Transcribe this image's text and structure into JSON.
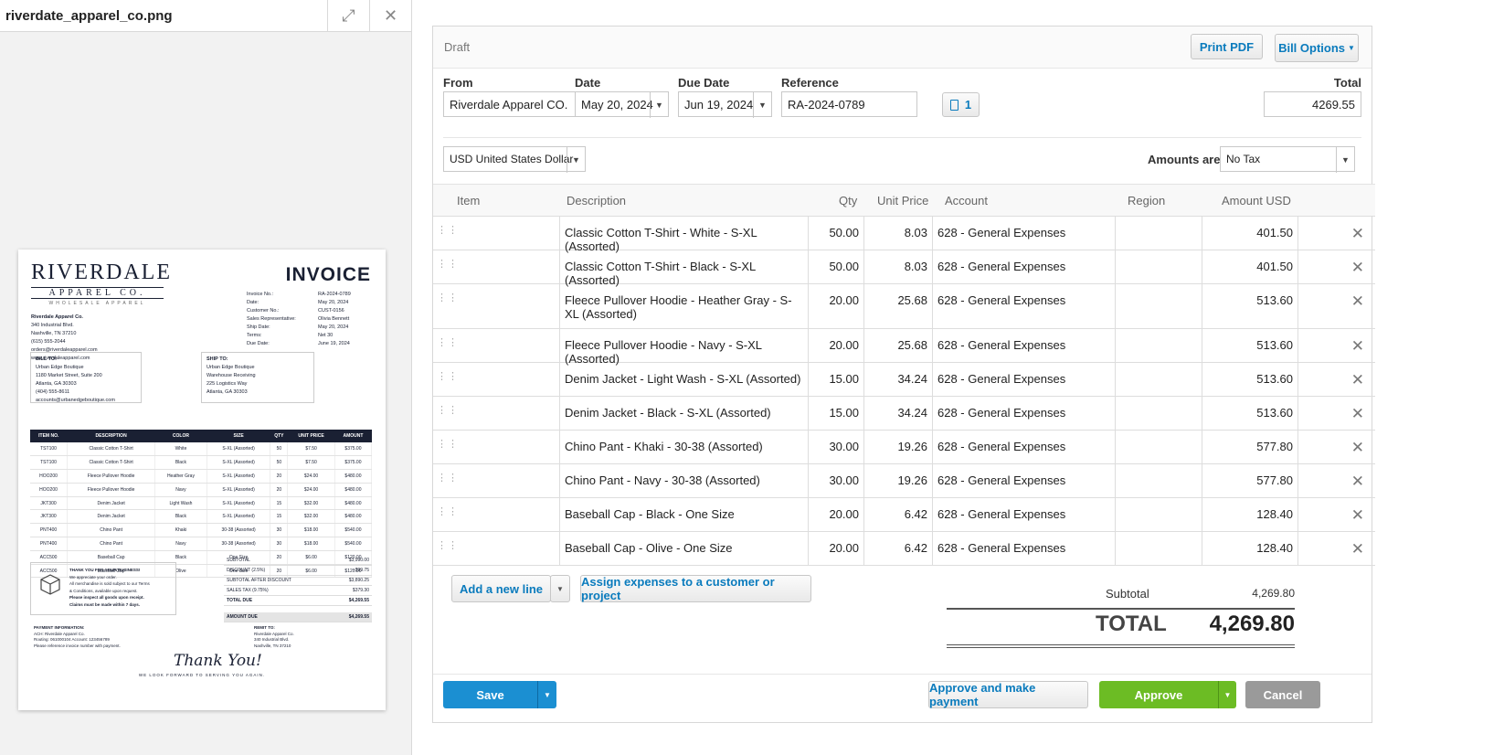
{
  "preview": {
    "filename": "riverdate_apparel_co.png",
    "document": {
      "logo": "RIVERDALE",
      "logo_sub": "APPAREL CO.",
      "logo_tag": "WHOLESALE APPAREL",
      "heading": "INVOICE",
      "company_lines": [
        "Riverdale Apparel Co.",
        "340 Industrial Blvd.",
        "Nashville, TN 37210",
        "(615) 555-2044",
        "orders@riverdaleapparel.com",
        "www.riverdaleapparel.com"
      ],
      "meta": [
        [
          "Invoice No.:",
          "RA-2024-0789"
        ],
        [
          "Date:",
          "May 20, 2024"
        ],
        [
          "Customer No.:",
          "CUST-0156"
        ],
        [
          "Sales Representative:",
          "Olivia Bennett"
        ],
        [
          "Ship Date:",
          "May 20, 2024"
        ],
        [
          "Terms:",
          "Net 30"
        ],
        [
          "Due Date:",
          "June 19, 2024"
        ]
      ],
      "bill_to": [
        "BILL TO:",
        "Urban Edge Boutique",
        "1180 Market Street, Suite 200",
        "Atlanta, GA 30303",
        "(404) 555-8611",
        "accounts@urbanedgeboutique.com"
      ],
      "ship_to": [
        "SHIP TO:",
        "Urban Edge Boutique",
        "Warehouse Receiving",
        "225 Logistics Way",
        "Atlanta, GA 30303"
      ],
      "table_headers": [
        "ITEM NO.",
        "DESCRIPTION",
        "COLOR",
        "SIZE",
        "QTY",
        "UNIT PRICE",
        "AMOUNT"
      ],
      "table_rows": [
        [
          "TST100",
          "Classic Cotton T-Shirt",
          "White",
          "S-XL (Assorted)",
          "50",
          "$7.50",
          "$375.00"
        ],
        [
          "TST100",
          "Classic Cotton T-Shirt",
          "Black",
          "S-XL (Assorted)",
          "50",
          "$7.50",
          "$375.00"
        ],
        [
          "HOO200",
          "Fleece Pullover Hoodie",
          "Heather Gray",
          "S-XL (Assorted)",
          "20",
          "$24.00",
          "$480.00"
        ],
        [
          "HOO200",
          "Fleece Pullover Hoodie",
          "Navy",
          "S-XL (Assorted)",
          "20",
          "$24.00",
          "$480.00"
        ],
        [
          "JKT300",
          "Denim Jacket",
          "Light Wash",
          "S-XL (Assorted)",
          "15",
          "$32.00",
          "$480.00"
        ],
        [
          "JKT300",
          "Denim Jacket",
          "Black",
          "S-XL (Assorted)",
          "15",
          "$32.00",
          "$480.00"
        ],
        [
          "PNT400",
          "Chino Pant",
          "Khaki",
          "30-38 (Assorted)",
          "30",
          "$18.00",
          "$540.00"
        ],
        [
          "PNT400",
          "Chino Pant",
          "Navy",
          "30-38 (Assorted)",
          "30",
          "$18.00",
          "$540.00"
        ],
        [
          "ACC500",
          "Baseball Cap",
          "Black",
          "One Size",
          "20",
          "$6.00",
          "$120.00"
        ],
        [
          "ACC500",
          "Baseball Cap",
          "Olive",
          "One Size",
          "20",
          "$6.00",
          "$120.00"
        ]
      ],
      "totals": [
        [
          "SUBTOTAL",
          "$3,990.00"
        ],
        [
          "DISCOUNT (2.5%)",
          "-$99.75"
        ],
        [
          "SUBTOTAL AFTER DISCOUNT",
          "$3,890.25"
        ],
        [
          "SALES TAX (9.75%)",
          "$379.30"
        ],
        [
          "TOTAL DUE",
          "$4,269.55"
        ],
        [
          "AMOUNT DUE",
          "$4,269.55"
        ]
      ],
      "thanks": [
        "THANK YOU FOR YOUR BUSINESS!",
        "We appreciate your order.",
        "All merchandise is sold subject to our Terms",
        "& Conditions, available upon request.",
        "Please inspect all goods upon receipt.",
        "Claims must be made within 7 days."
      ],
      "payment": [
        "PAYMENT INFORMATION:",
        "ACH: Riverdale Apparel Co.",
        "Routing: 061000104    Account: 123456789",
        "Please reference invoice number with payment."
      ],
      "remit": [
        "REMIT TO:",
        "Riverdale Apparel Co.",
        "340 Industrial Blvd.",
        "Nashville, TN 37210"
      ],
      "signature": "Thank You!",
      "footer": "WE LOOK FORWARD TO SERVING YOU AGAIN."
    }
  },
  "form": {
    "status": "Draft",
    "print_pdf": "Print PDF",
    "bill_options": "Bill Options",
    "labels": {
      "from": "From",
      "date": "Date",
      "due_date": "Due Date",
      "reference": "Reference",
      "total": "Total",
      "amounts_are": "Amounts are"
    },
    "from": "Riverdale Apparel CO.",
    "date": "May 20, 2024",
    "due_date": "Jun 19, 2024",
    "reference": "RA-2024-0789",
    "attachments": "1",
    "total": "4269.55",
    "currency": "USD United States Dollar",
    "tax_mode": "No Tax",
    "columns": [
      "Item",
      "Description",
      "Qty",
      "Unit Price",
      "Account",
      "Region",
      "Amount USD"
    ],
    "lines": [
      {
        "item": "",
        "description": "Classic Cotton T-Shirt - White - S-XL (Assorted)",
        "qty": "50.00",
        "price": "8.03",
        "account": "628 - General Expenses",
        "region": "",
        "amount": "401.50"
      },
      {
        "item": "",
        "description": "Classic Cotton T-Shirt - Black - S-XL (Assorted)",
        "qty": "50.00",
        "price": "8.03",
        "account": "628 - General Expenses",
        "region": "",
        "amount": "401.50"
      },
      {
        "item": "",
        "description": "Fleece Pullover Hoodie - Heather Gray - S-XL (Assorted)",
        "qty": "20.00",
        "price": "25.68",
        "account": "628 - General Expenses",
        "region": "",
        "amount": "513.60"
      },
      {
        "item": "",
        "description": "Fleece Pullover Hoodie - Navy - S-XL (Assorted)",
        "qty": "20.00",
        "price": "25.68",
        "account": "628 - General Expenses",
        "region": "",
        "amount": "513.60"
      },
      {
        "item": "",
        "description": "Denim Jacket - Light Wash - S-XL (Assorted)",
        "qty": "15.00",
        "price": "34.24",
        "account": "628 - General Expenses",
        "region": "",
        "amount": "513.60"
      },
      {
        "item": "",
        "description": "Denim Jacket - Black - S-XL (Assorted)",
        "qty": "15.00",
        "price": "34.24",
        "account": "628 - General Expenses",
        "region": "",
        "amount": "513.60"
      },
      {
        "item": "",
        "description": "Chino Pant - Khaki - 30-38 (Assorted)",
        "qty": "30.00",
        "price": "19.26",
        "account": "628 - General Expenses",
        "region": "",
        "amount": "577.80"
      },
      {
        "item": "",
        "description": "Chino Pant - Navy - 30-38 (Assorted)",
        "qty": "30.00",
        "price": "19.26",
        "account": "628 - General Expenses",
        "region": "",
        "amount": "577.80"
      },
      {
        "item": "",
        "description": "Baseball Cap - Black - One Size",
        "qty": "20.00",
        "price": "6.42",
        "account": "628 - General Expenses",
        "region": "",
        "amount": "128.40"
      },
      {
        "item": "",
        "description": "Baseball Cap - Olive - One Size",
        "qty": "20.00",
        "price": "6.42",
        "account": "628 - General Expenses",
        "region": "",
        "amount": "128.40"
      }
    ],
    "add_line": "Add a new line",
    "assign": "Assign expenses to a customer or project",
    "subtotal_label": "Subtotal",
    "subtotal": "4,269.80",
    "total_label": "TOTAL",
    "grand_total": "4,269.80",
    "save": "Save",
    "approve_pay": "Approve and make payment",
    "approve": "Approve",
    "cancel": "Cancel"
  },
  "colors": {
    "link": "#0a7bbd",
    "save": "#1b8fd2",
    "approve": "#6cbc24",
    "cancel": "#9a9a9a",
    "doc_navy": "#1a2033"
  },
  "icons": [
    "expand-icon",
    "close-icon",
    "chevron-down-icon",
    "attachment-icon",
    "drag-handle-icon",
    "delete-icon",
    "box-icon"
  ]
}
